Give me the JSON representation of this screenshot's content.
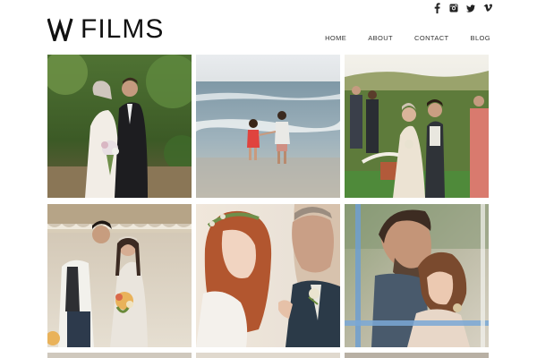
{
  "brand": {
    "logo_mark": "W",
    "logo_text": "FILMS"
  },
  "social": [
    {
      "icon": "facebook-icon"
    },
    {
      "icon": "instagram-icon"
    },
    {
      "icon": "twitter-icon"
    },
    {
      "icon": "vimeo-icon"
    }
  ],
  "nav": {
    "items": [
      "HOME",
      "ABOUT",
      "CONTACT",
      "BLOG"
    ]
  },
  "gallery": {
    "tiles": [
      {
        "subject": "couple-embrace-garden"
      },
      {
        "subject": "couple-walking-beach"
      },
      {
        "subject": "bride-groom-ceremony-guests"
      },
      {
        "subject": "couple-desert-tent"
      },
      {
        "subject": "redhead-bride-groom-closeup"
      },
      {
        "subject": "couple-through-window"
      }
    ]
  },
  "colors": {
    "text": "#222222",
    "nav": "#333333",
    "background": "#ffffff"
  }
}
